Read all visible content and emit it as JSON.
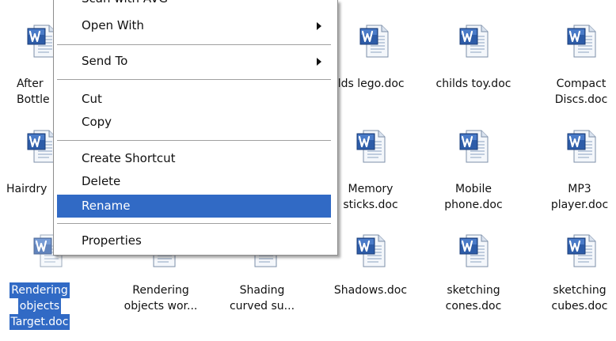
{
  "context_menu": {
    "clipped_top_item": "Scan with AVG",
    "items": [
      {
        "label": "Open With",
        "submenu": true
      },
      {
        "label": "Send To",
        "submenu": true
      },
      {
        "label": "Cut"
      },
      {
        "label": "Copy"
      },
      {
        "label": "Create Shortcut"
      },
      {
        "label": "Delete"
      },
      {
        "label": "Rename",
        "highlighted": true
      },
      {
        "label": "Properties"
      }
    ],
    "highlight_color": "#316AC5"
  },
  "files": [
    {
      "lines": [
        "After",
        "Bottle"
      ]
    },
    {
      "lines": [
        "hilds lego.doc"
      ]
    },
    {
      "lines": [
        "childs toy.doc"
      ]
    },
    {
      "lines": [
        "Compact",
        "Discs.doc"
      ]
    },
    {
      "lines": [
        "Hairdry"
      ]
    },
    {
      "lines": [
        "Memory",
        "sticks.doc"
      ]
    },
    {
      "lines": [
        "Mobile",
        "phone.doc"
      ]
    },
    {
      "lines": [
        "MP3",
        "player.doc"
      ]
    },
    {
      "lines": [
        "Rendering",
        "objects",
        "Target.doc"
      ],
      "selected": true
    },
    {
      "lines": [
        "Rendering",
        "objects wor..."
      ]
    },
    {
      "lines": [
        "Shading",
        "curved su..."
      ]
    },
    {
      "lines": [
        "Shadows.doc"
      ]
    },
    {
      "lines": [
        "sketching",
        "cones.doc"
      ]
    },
    {
      "lines": [
        "sketching",
        "cubes.doc"
      ]
    }
  ],
  "icon_type": "word-document-icon",
  "selection_color": "#316AC5"
}
